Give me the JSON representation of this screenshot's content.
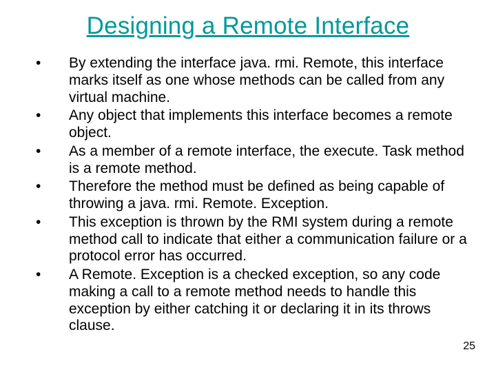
{
  "title": "Designing a Remote Interface",
  "bullets": [
    "By extending the interface java. rmi. Remote, this interface marks itself as one whose methods can be called from any virtual machine.",
    "Any object that implements this interface becomes a remote object.",
    "As a member of a remote interface, the execute. Task method is a remote method.",
    "Therefore the method must be defined as being capable of throwing a java. rmi. Remote. Exception.",
    "This exception is thrown by the RMI system during a remote method call to indicate that either a communication failure or a protocol error has occurred.",
    "A Remote. Exception is a checked exception, so any code making a call to a remote method needs to handle this exception by either catching it or declaring it in its throws clause."
  ],
  "page_number": "25"
}
